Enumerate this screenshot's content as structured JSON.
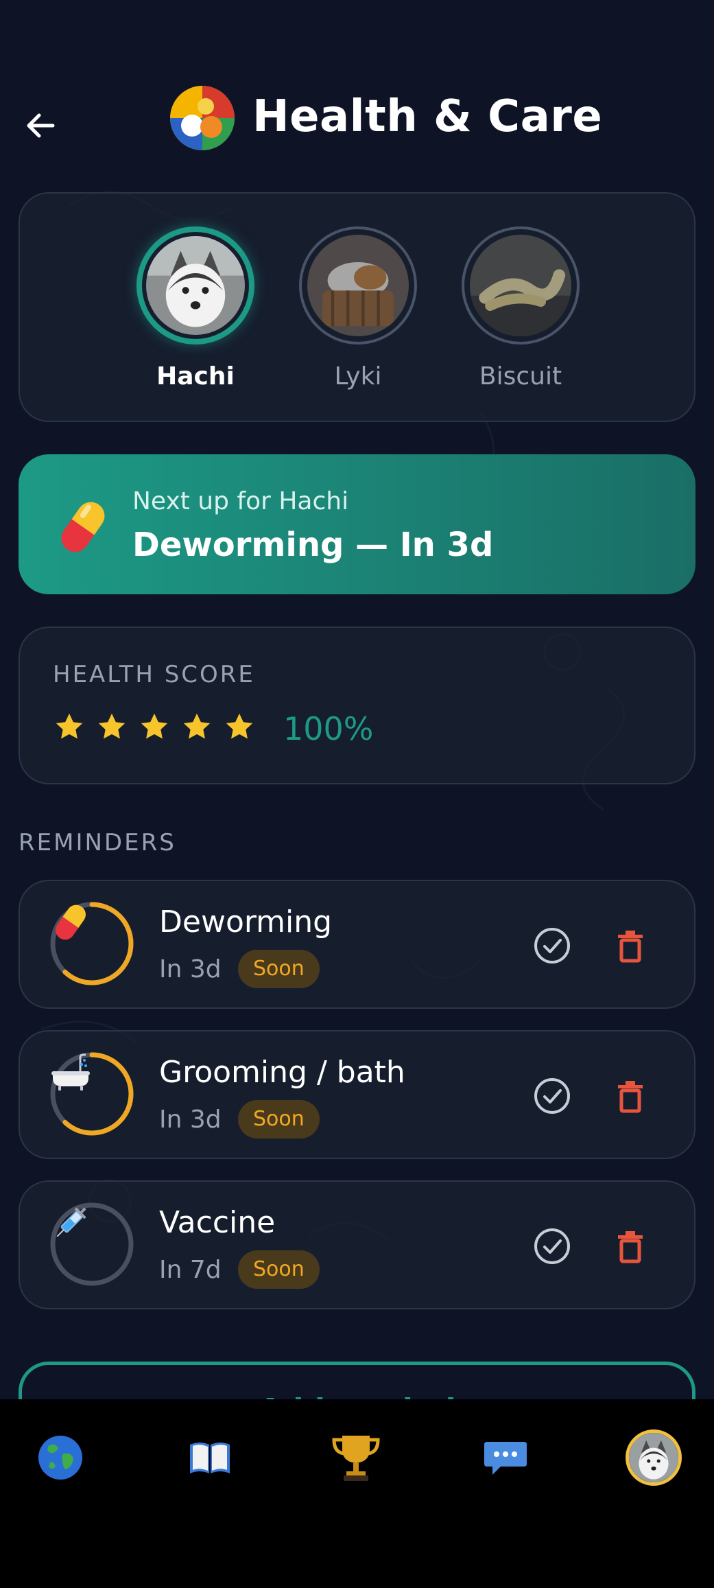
{
  "header": {
    "title": "Health & Care"
  },
  "pets": [
    {
      "name": "Hachi",
      "active": true
    },
    {
      "name": "Lyki",
      "active": false
    },
    {
      "name": "Biscuit",
      "active": false
    }
  ],
  "next_up": {
    "label": "Next up for Hachi",
    "value": "Deworming — In 3d"
  },
  "health_score": {
    "label": "HEALTH SCORE",
    "stars": 5,
    "percent": "100%"
  },
  "reminders": {
    "heading": "REMINDERS",
    "items": [
      {
        "title": "Deworming",
        "due": "In 3d",
        "badge": "Soon",
        "icon": "pill-icon",
        "progress": 0.62
      },
      {
        "title": "Grooming / bath",
        "due": "In 3d",
        "badge": "Soon",
        "icon": "bathtub-icon",
        "progress": 0.62
      },
      {
        "title": "Vaccine",
        "due": "In 7d",
        "badge": "Soon",
        "icon": "syringe-icon",
        "progress": 0.0
      }
    ]
  },
  "add_button": {
    "label": "+ Add reminder"
  },
  "nav": [
    {
      "icon": "globe-icon"
    },
    {
      "icon": "book-icon"
    },
    {
      "icon": "trophy-icon"
    },
    {
      "icon": "chat-icon"
    },
    {
      "icon": "profile-avatar"
    }
  ],
  "colors": {
    "background": "#0e1426",
    "accent": "#1d9a86",
    "warning": "#f0a824",
    "danger": "#e8553d",
    "star": "#f7c52b"
  }
}
